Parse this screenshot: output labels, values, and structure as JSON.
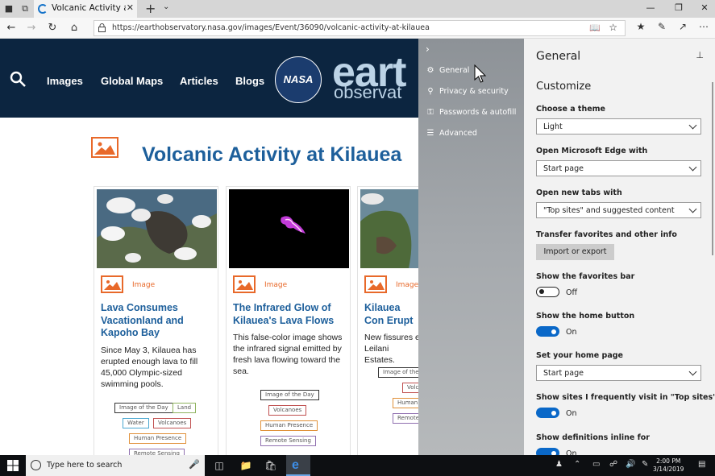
{
  "browser": {
    "tab_title": "Volcanic Activity at Kilaue",
    "url": "https://earthobservatory.nasa.gov/images/Event/36090/volcanic-activity-at-kilauea"
  },
  "site": {
    "nav": [
      "Images",
      "Global Maps",
      "Articles",
      "Blogs"
    ],
    "logo_nasa": "NASA",
    "logo_word": "eart",
    "logo_sub": "observat",
    "page_title": "Volcanic Activity at Kilauea",
    "cards": [
      {
        "type": "Image",
        "title": "Lava Consumes Vacationland and Kapoho Bay",
        "desc": "Since May 3, Kilauea has erupted enough lava to fill 45,000 Olympic-sized swimming pools.",
        "tags": [
          "Image of the Day",
          "Land",
          "Water",
          "Volcanoes",
          "Human Presence",
          "Remote Sensing"
        ]
      },
      {
        "type": "Image",
        "title": "The Infrared Glow of Kilauea's Lava Flows",
        "desc": "This false-color image shows the infrared signal emitted by fresh lava flowing toward the sea.",
        "tags": [
          "Image of the Day",
          "Volcanoes",
          "Human Presence",
          "Remote Sensing"
        ]
      },
      {
        "type": "Image",
        "title": "Kilauea Con Erupt",
        "desc": "New fissures e Leilani Estates.",
        "tags": [
          "Image of the",
          "Volc",
          "Human",
          "Remote"
        ]
      }
    ]
  },
  "settings_nav": {
    "items": [
      "General",
      "Privacy & security",
      "Passwords & autofill",
      "Advanced"
    ]
  },
  "settings": {
    "title": "General",
    "section": "Customize",
    "theme_label": "Choose a theme",
    "theme_value": "Light",
    "open_with_label": "Open Microsoft Edge with",
    "open_with_value": "Start page",
    "new_tabs_label": "Open new tabs with",
    "new_tabs_value": "\"Top sites\" and suggested content",
    "transfer_label": "Transfer favorites and other info",
    "import_button": "Import or export",
    "fav_bar_label": "Show the favorites bar",
    "fav_bar_state": "Off",
    "home_btn_label": "Show the home button",
    "home_btn_state": "On",
    "home_page_label": "Set your home page",
    "home_page_value": "Start page",
    "top_sites_label": "Show sites I frequently visit in \"Top sites\"",
    "top_sites_state": "On",
    "definitions_label": "Show definitions inline for",
    "definitions_state": "On"
  },
  "taskbar": {
    "search_placeholder": "Type here to search",
    "time": "2:00 PM",
    "date": "3/14/2019"
  },
  "colors": {
    "nasa_header": "#0c2540",
    "link_blue": "#1d5f9b",
    "accent_orange": "#e8692a",
    "toggle_on": "#0a68c8"
  }
}
